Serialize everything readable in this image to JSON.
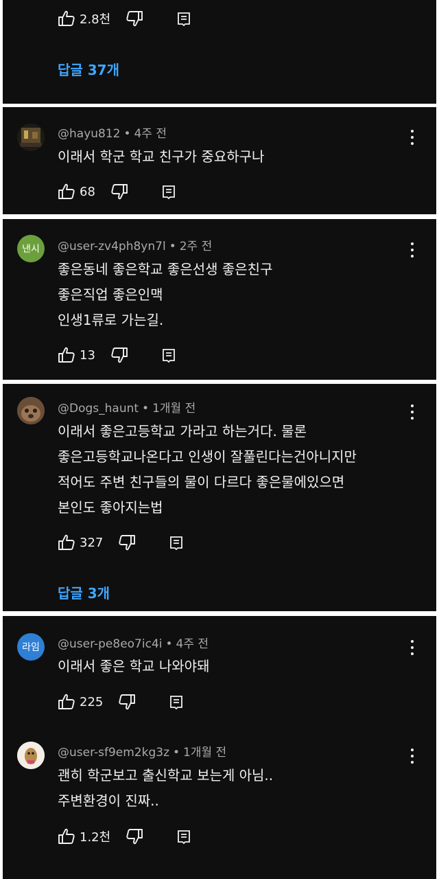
{
  "thread0": {
    "likes": "2.8천",
    "replies_label": "답글 37개"
  },
  "comment1": {
    "author": "@hayu812",
    "time": "4주 전",
    "lines": [
      "이래서 학군 학교 친구가 중요하구나"
    ],
    "likes": "68"
  },
  "comment2": {
    "avatar_text": "낸시",
    "avatar_color": "#6ca03c",
    "author": "@user-zv4ph8yn7l",
    "time": "2주 전",
    "lines": [
      "좋은동네 좋은학교 좋은선생 좋은친구",
      "좋은직업 좋은인맥",
      "인생1류로 가는길."
    ],
    "likes": "13"
  },
  "comment3": {
    "author": "@Dogs_haunt",
    "time": "1개월 전",
    "lines": [
      "이래서 좋은고등학교 가라고 하는거다. 물론",
      "좋은고등학교나온다고 인생이 잘풀린다는건아니지만",
      "적어도 주변 친구들의 물이 다르다 좋은물에있으면",
      "본인도 좋아지는법"
    ],
    "likes": "327",
    "replies_label": "답글 3개"
  },
  "comment4": {
    "avatar_text": "라임",
    "avatar_color": "#2f7fd4",
    "author": "@user-pe8eo7ic4i",
    "time": "4주 전",
    "lines": [
      "이래서 좋은 학교 나와야돼"
    ],
    "likes": "225"
  },
  "comment5": {
    "author": "@user-sf9em2kg3z",
    "time": "1개월 전",
    "lines": [
      "괜히 학군보고 출신학교 보는게 아님..",
      "주변환경이 진짜.."
    ],
    "likes": "1.2천"
  },
  "icons": {
    "like": "thumbs-up-icon",
    "dislike": "thumbs-down-icon",
    "reply": "comment-reply-icon",
    "more": "more-vert-icon"
  },
  "colors": {
    "background": "#0f0f0f",
    "text": "#f1f1f1",
    "meta": "#aaaaaa",
    "link": "#3ea6ff"
  }
}
